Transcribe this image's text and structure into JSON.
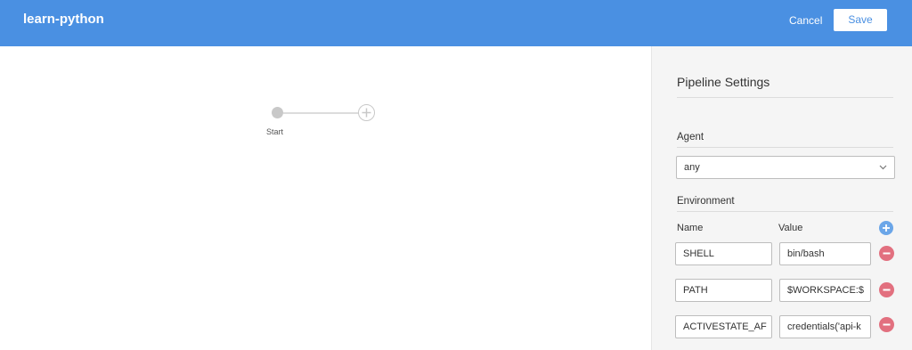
{
  "header": {
    "title": "learn-python",
    "cancel_label": "Cancel",
    "save_label": "Save",
    "background_color": "#4a90e2"
  },
  "canvas": {
    "start_label": "Start",
    "add_stage_icon": "plus-circle-icon"
  },
  "settings": {
    "title": "Pipeline Settings",
    "agent_label": "Agent",
    "agent_value": "any",
    "environment_label": "Environment",
    "name_column": "Name",
    "value_column": "Value",
    "add_icon": "plus-circle-icon",
    "remove_icon": "minus-circle-icon",
    "env": [
      {
        "name": "SHELL",
        "value": "bin/bash"
      },
      {
        "name": "PATH",
        "value": "$WORKSPACE:$"
      },
      {
        "name": "ACTIVESTATE_AF",
        "value": "credentials('api-k"
      }
    ],
    "colors": {
      "add": "#6ba6e8",
      "remove": "#e2707f"
    }
  }
}
